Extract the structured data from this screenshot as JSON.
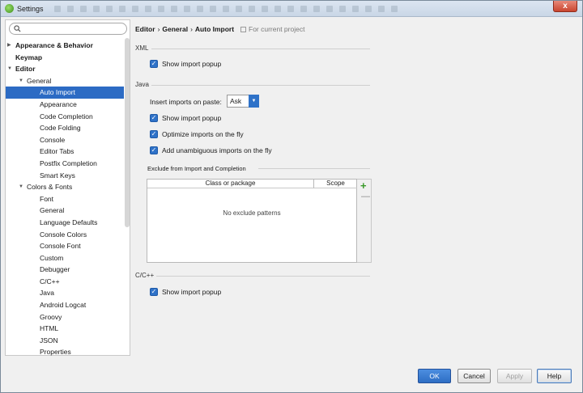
{
  "window": {
    "title": "Settings",
    "close_label": "x"
  },
  "sidebar": {
    "search_placeholder": "",
    "items": [
      {
        "label": "Appearance & Behavior",
        "level": 0,
        "bold": true,
        "arrow": "right"
      },
      {
        "label": "Keymap",
        "level": 0,
        "bold": true,
        "arrow": ""
      },
      {
        "label": "Editor",
        "level": 0,
        "bold": true,
        "arrow": "down"
      },
      {
        "label": "General",
        "level": 1,
        "bold": false,
        "arrow": "down"
      },
      {
        "label": "Auto Import",
        "level": 2,
        "bold": false,
        "arrow": "",
        "selected": true
      },
      {
        "label": "Appearance",
        "level": 2,
        "bold": false,
        "arrow": ""
      },
      {
        "label": "Code Completion",
        "level": 2,
        "bold": false,
        "arrow": ""
      },
      {
        "label": "Code Folding",
        "level": 2,
        "bold": false,
        "arrow": ""
      },
      {
        "label": "Console",
        "level": 2,
        "bold": false,
        "arrow": ""
      },
      {
        "label": "Editor Tabs",
        "level": 2,
        "bold": false,
        "arrow": ""
      },
      {
        "label": "Postfix Completion",
        "level": 2,
        "bold": false,
        "arrow": ""
      },
      {
        "label": "Smart Keys",
        "level": 2,
        "bold": false,
        "arrow": ""
      },
      {
        "label": "Colors & Fonts",
        "level": 1,
        "bold": false,
        "arrow": "down"
      },
      {
        "label": "Font",
        "level": 2,
        "bold": false,
        "arrow": ""
      },
      {
        "label": "General",
        "level": 2,
        "bold": false,
        "arrow": ""
      },
      {
        "label": "Language Defaults",
        "level": 2,
        "bold": false,
        "arrow": ""
      },
      {
        "label": "Console Colors",
        "level": 2,
        "bold": false,
        "arrow": ""
      },
      {
        "label": "Console Font",
        "level": 2,
        "bold": false,
        "arrow": ""
      },
      {
        "label": "Custom",
        "level": 2,
        "bold": false,
        "arrow": ""
      },
      {
        "label": "Debugger",
        "level": 2,
        "bold": false,
        "arrow": ""
      },
      {
        "label": "C/C++",
        "level": 2,
        "bold": false,
        "arrow": ""
      },
      {
        "label": "Java",
        "level": 2,
        "bold": false,
        "arrow": ""
      },
      {
        "label": "Android Logcat",
        "level": 2,
        "bold": false,
        "arrow": ""
      },
      {
        "label": "Groovy",
        "level": 2,
        "bold": false,
        "arrow": ""
      },
      {
        "label": "HTML",
        "level": 2,
        "bold": false,
        "arrow": ""
      },
      {
        "label": "JSON",
        "level": 2,
        "bold": false,
        "arrow": ""
      },
      {
        "label": "Properties",
        "level": 2,
        "bold": false,
        "arrow": ""
      }
    ]
  },
  "breadcrumb": {
    "part1": "Editor",
    "part2": "General",
    "part3": "Auto Import",
    "separator": "›",
    "note": "For current project"
  },
  "xml": {
    "section_label": "XML",
    "show_import_popup": {
      "label": "Show import popup",
      "checked": true
    }
  },
  "java": {
    "section_label": "Java",
    "insert_imports_label": "Insert imports on paste:",
    "insert_imports_value": "Ask",
    "show_import_popup": {
      "label": "Show import popup",
      "checked": true
    },
    "optimize_imports": {
      "label": "Optimize imports on the fly",
      "checked": true
    },
    "add_unambiguous": {
      "label": "Add unambiguous imports on the fly",
      "checked": true
    },
    "exclude_title": "Exclude from Import and Completion",
    "table_col_class": "Class or package",
    "table_col_scope": "Scope",
    "empty_text": "No exclude patterns",
    "add_symbol": "+",
    "remove_symbol": "—"
  },
  "cpp": {
    "section_label": "C/C++",
    "show_import_popup": {
      "label": "Show import popup",
      "checked": true
    }
  },
  "footer": {
    "ok": "OK",
    "cancel": "Cancel",
    "apply": "Apply",
    "help": "Help"
  },
  "colors": {
    "accent": "#2f72c8",
    "selection": "#2c6bc4",
    "add_green": "#3a9a2a"
  }
}
